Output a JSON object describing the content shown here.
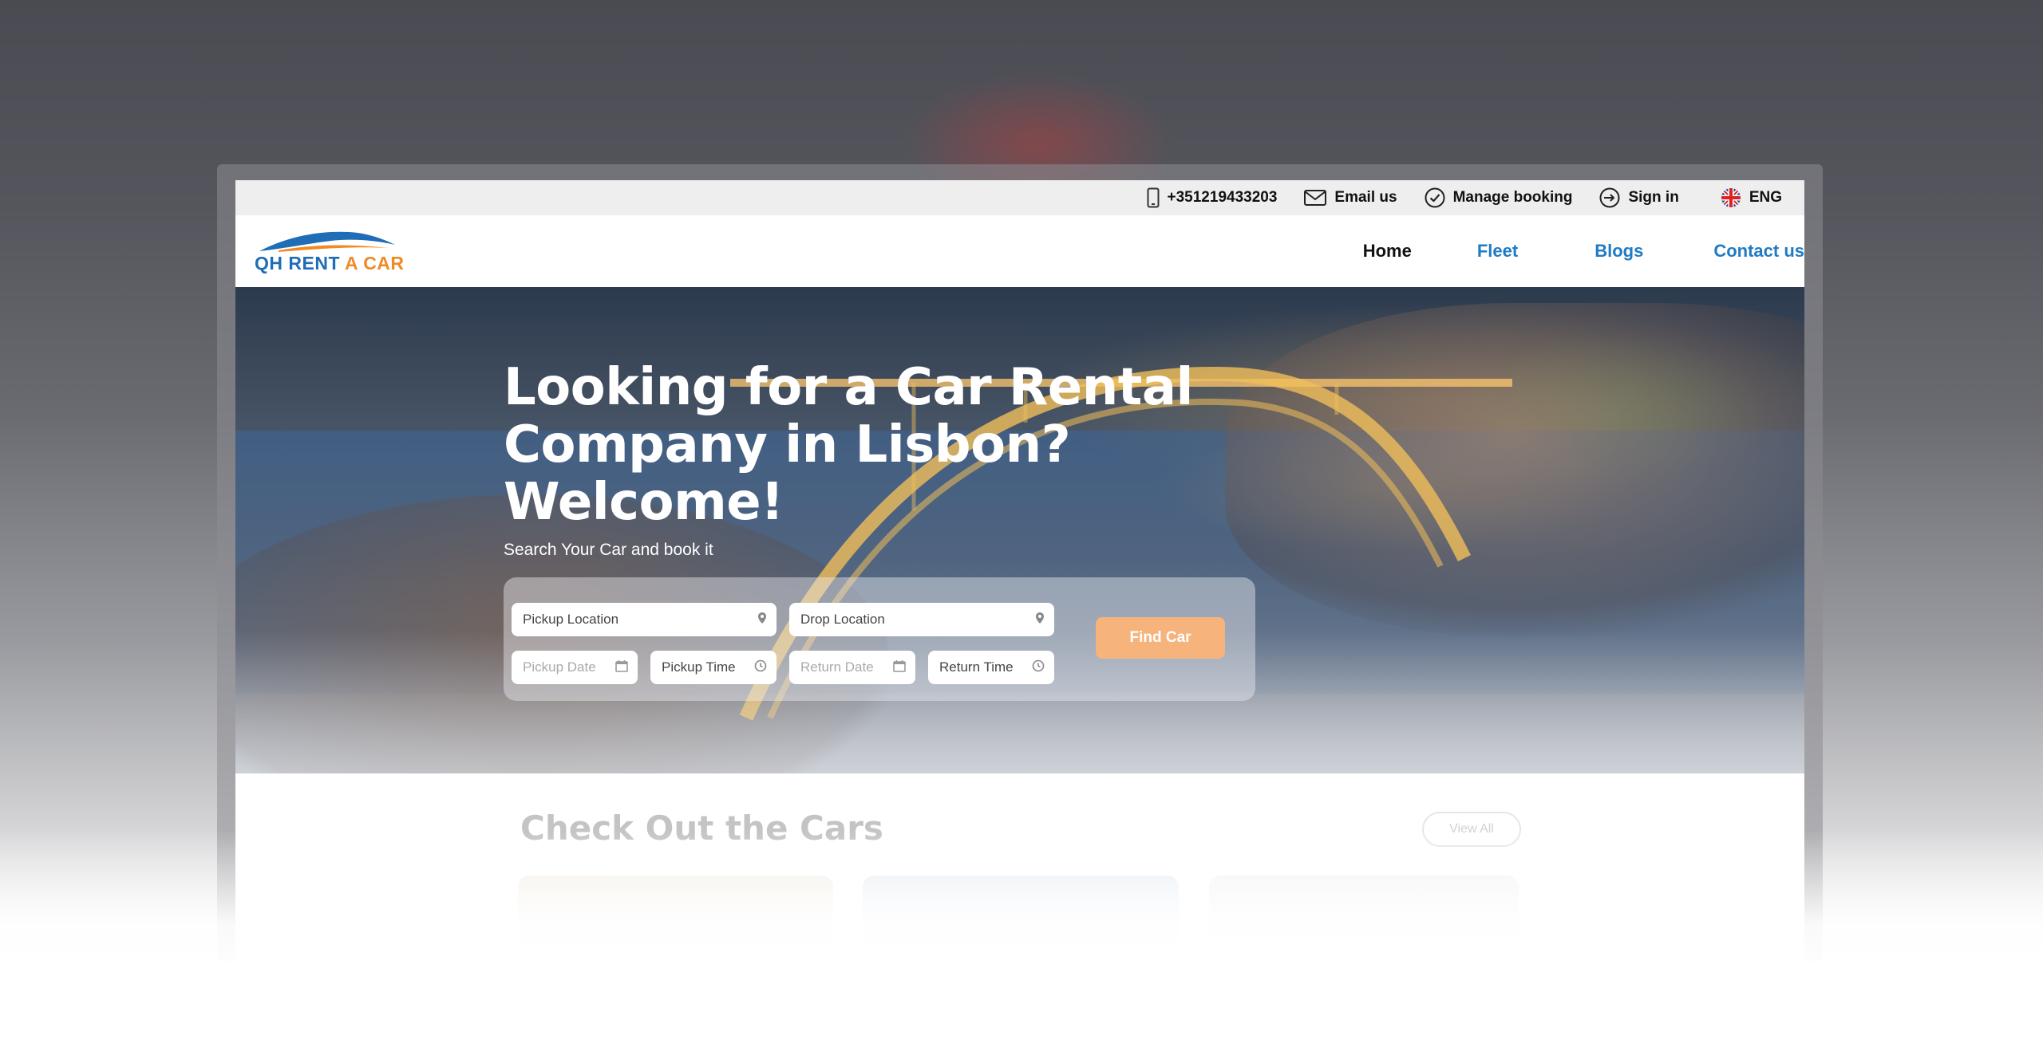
{
  "topbar": {
    "phone": "+351219433203",
    "email_label": "Email us",
    "manage_label": "Manage booking",
    "signin_label": "Sign in",
    "language": "ENG"
  },
  "logo": {
    "text_part1": "QH RENT ",
    "text_part2": "A CAR"
  },
  "nav": {
    "home": "Home",
    "fleet": "Fleet",
    "blogs": "Blogs",
    "contact": "Contact us"
  },
  "hero": {
    "title_line1": "Looking for a Car Rental",
    "title_line2": "Company in Lisbon?",
    "title_line3": "Welcome!",
    "subtitle": "Search Your Car and book it"
  },
  "search": {
    "pickup_location": "Pickup Location",
    "drop_location": "Drop Location",
    "pickup_date": "Pickup Date",
    "pickup_time": "Pickup Time",
    "return_date": "Return Date",
    "return_time": "Return Time",
    "find_button": "Find Car"
  },
  "cars_section": {
    "title": "Check Out the Cars",
    "view_all": "View All"
  },
  "colors": {
    "brand_blue": "#1f6db7",
    "brand_orange": "#f08a24",
    "nav_link": "#1f7bc4",
    "find_button": "#f6b47c"
  }
}
